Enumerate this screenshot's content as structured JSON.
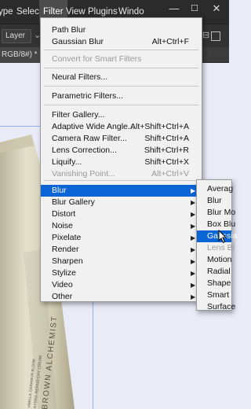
{
  "menubar": {
    "items": [
      "ype",
      "Select",
      "Filter",
      "View",
      "Plugins",
      "Windo"
    ],
    "window_buttons": [
      "—",
      "☐",
      "✕"
    ]
  },
  "options_bar": {
    "layer_select": "Layer"
  },
  "doc_tab": {
    "label": "RGB/8#) *"
  },
  "filter_menu": {
    "groups": [
      [
        {
          "label": "Path Blur",
          "shortcut": ""
        },
        {
          "label": "Gaussian Blur",
          "shortcut": "Alt+Ctrl+F"
        }
      ],
      [
        {
          "label": "Convert for Smart Filters",
          "shortcut": "",
          "disabled": true
        }
      ],
      [
        {
          "label": "Neural Filters...",
          "shortcut": ""
        }
      ],
      [
        {
          "label": "Parametric Filters...",
          "shortcut": ""
        }
      ],
      [
        {
          "label": "Filter Gallery...",
          "shortcut": ""
        },
        {
          "label": "Adaptive Wide Angle...",
          "shortcut": "Alt+Shift+Ctrl+A"
        },
        {
          "label": "Camera Raw Filter...",
          "shortcut": "Shift+Ctrl+A"
        },
        {
          "label": "Lens Correction...",
          "shortcut": "Shift+Ctrl+R"
        },
        {
          "label": "Liquify...",
          "shortcut": "Shift+Ctrl+X"
        },
        {
          "label": "Vanishing Point...",
          "shortcut": "Alt+Ctrl+V",
          "disabled": true
        }
      ],
      [
        {
          "label": "Blur",
          "submenu": true,
          "highlighted": true
        },
        {
          "label": "Blur Gallery",
          "submenu": true
        },
        {
          "label": "Distort",
          "submenu": true
        },
        {
          "label": "Noise",
          "submenu": true
        },
        {
          "label": "Pixelate",
          "submenu": true
        },
        {
          "label": "Render",
          "submenu": true
        },
        {
          "label": "Sharpen",
          "submenu": true
        },
        {
          "label": "Stylize",
          "submenu": true
        },
        {
          "label": "Video",
          "submenu": true
        },
        {
          "label": "Other",
          "submenu": true
        }
      ]
    ]
  },
  "blur_submenu": {
    "items": [
      {
        "label": "Averag"
      },
      {
        "label": "Blur"
      },
      {
        "label": "Blur Mo"
      },
      {
        "label": "Box Blu"
      },
      {
        "label": "Gaussia",
        "highlighted": true
      },
      {
        "label": "Lens Bl",
        "disabled": true
      },
      {
        "label": "Motion"
      },
      {
        "label": "Radial"
      },
      {
        "label": "Shape"
      },
      {
        "label": "Smart"
      },
      {
        "label": "Surface"
      }
    ]
  },
  "product": {
    "label_lines": [
      "BROWN ALCHEMIST",
      "HYDRA-REPAIR DAY CREAM",
      "VANILLA, GERANIUM BLOOM"
    ]
  },
  "colors": {
    "menubar_bg": "#2b2b2b",
    "menu_bg": "#f1f1f1",
    "highlight": "#0a64d6",
    "canvas_bg": "#e9ebf7",
    "tube": "#d8d4bd"
  }
}
